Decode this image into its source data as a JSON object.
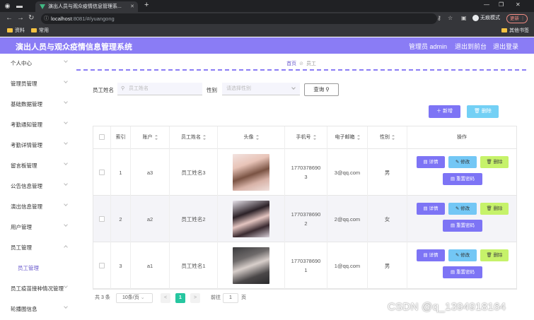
{
  "browser": {
    "tab_title": "演出人员与观众疫情信息管理系...",
    "url_host": "localhost",
    "url_path": ":8081/#/yuangong",
    "incognito_label": "无痕模式",
    "update_label": "更新",
    "bookmarks": [
      {
        "label": "资料"
      },
      {
        "label": "常用"
      }
    ],
    "other_bookmarks_label": "其他书签"
  },
  "header": {
    "title": "演出人员与观众疫情信息管理系统",
    "user_label": "管理员 admin",
    "back_label": "退出到前台",
    "logout_label": "退出登录"
  },
  "sidebar": {
    "items": [
      {
        "label": "个人中心",
        "icon": "chevron-down-icon"
      },
      {
        "label": "管理员管理",
        "icon": "chevron-down-icon"
      },
      {
        "label": "基础数据管理",
        "icon": "chevron-down-icon"
      },
      {
        "label": "考勤通知管理",
        "icon": "chevron-down-icon"
      },
      {
        "label": "考勤详情管理",
        "icon": "chevron-down-icon"
      },
      {
        "label": "留言板管理",
        "icon": "chevron-down-icon"
      },
      {
        "label": "公告信息管理",
        "icon": "chevron-down-icon"
      },
      {
        "label": "演出信息管理",
        "icon": "chevron-down-icon"
      },
      {
        "label": "用户管理",
        "icon": "chevron-down-icon"
      },
      {
        "label": "员工管理",
        "icon": "chevron-up-icon",
        "expanded": true
      },
      {
        "label": "员工管理",
        "sub": true,
        "active": true
      },
      {
        "label": "员工疫苗接种情况管理",
        "icon": "chevron-down-icon"
      },
      {
        "label": "轮播图信息",
        "icon": "chevron-down-icon"
      }
    ]
  },
  "breadcrumb": {
    "home": "首页",
    "current": "员工"
  },
  "filters": {
    "name_label": "员工姓名",
    "name_placeholder": "员工姓名",
    "gender_label": "性别",
    "gender_placeholder": "请选择性别",
    "search_label": "查询"
  },
  "actions": {
    "add_label": "新增",
    "delete_label": "删除"
  },
  "table": {
    "headers": {
      "index": "索引",
      "account": "账户",
      "name": "员工姓名",
      "avatar": "头像",
      "phone": "手机号",
      "email": "电子邮箱",
      "gender": "性别",
      "ops": "操作"
    },
    "rows": [
      {
        "index": "1",
        "account": "a3",
        "name": "员工姓名3",
        "phone_line1": "1770378690",
        "phone_line2": "3",
        "email": "3@qq.com",
        "gender": "男"
      },
      {
        "index": "2",
        "account": "a2",
        "name": "员工姓名2",
        "phone_line1": "1770378690",
        "phone_line2": "2",
        "email": "2@qq.com",
        "gender": "女"
      },
      {
        "index": "3",
        "account": "a1",
        "name": "员工姓名1",
        "phone_line1": "1770378690",
        "phone_line2": "1",
        "email": "1@qq.com",
        "gender": "男"
      }
    ],
    "row_ops": {
      "detail": "详情",
      "edit": "修改",
      "remove": "删除",
      "reset": "重置密码"
    }
  },
  "pagination": {
    "total": "共 3 条",
    "page_size": "10条/页",
    "prev": "<",
    "current": "1",
    "next": ">",
    "goto_label": "前往",
    "goto_value": "1",
    "page_unit": "页"
  },
  "watermark": "CSDN @q_1394918164"
}
